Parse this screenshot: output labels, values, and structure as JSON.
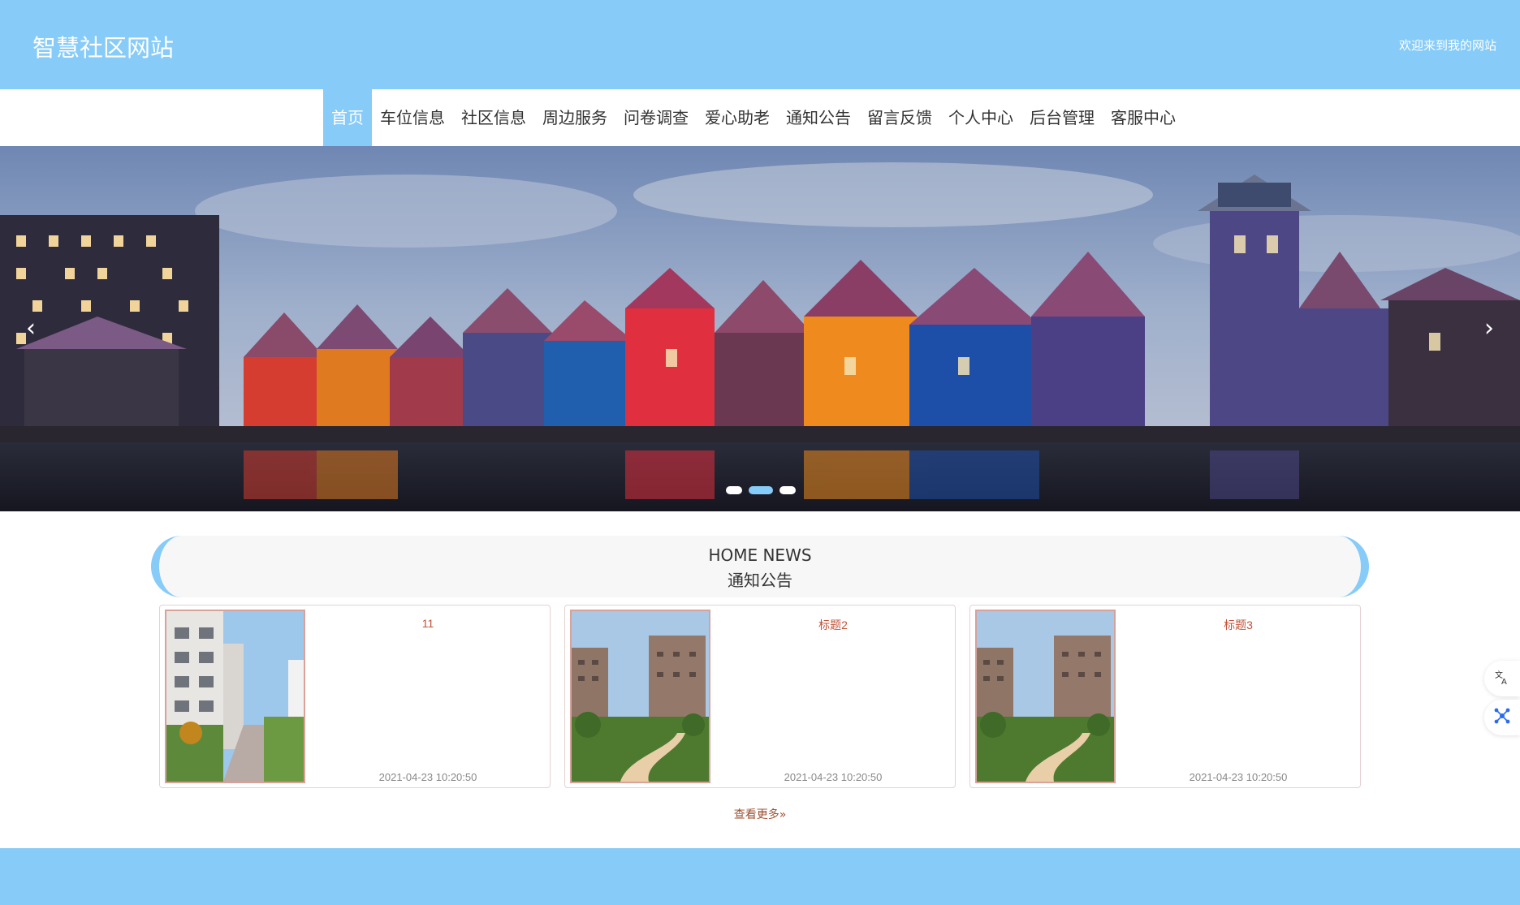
{
  "header": {
    "site_title": "智慧社区网站",
    "welcome_text": "欢迎来到我的网站"
  },
  "nav": {
    "items": [
      {
        "label": "首页",
        "active": true
      },
      {
        "label": "车位信息"
      },
      {
        "label": "社区信息"
      },
      {
        "label": "周边服务"
      },
      {
        "label": "问卷调查"
      },
      {
        "label": "爱心助老"
      },
      {
        "label": "通知公告"
      },
      {
        "label": "留言反馈"
      },
      {
        "label": "个人中心"
      },
      {
        "label": "后台管理"
      },
      {
        "label": "客服中心"
      }
    ]
  },
  "banner": {
    "prev_arrow": "‹",
    "next_arrow": "›",
    "slide_count": 3,
    "active_slide": 2
  },
  "news": {
    "title_en": "HOME NEWS",
    "title_cn": "通知公告",
    "cards": [
      {
        "title": "11",
        "date": "2021-04-23 10:20:50"
      },
      {
        "title": "标题2",
        "date": "2021-04-23 10:20:50"
      },
      {
        "title": "标题3",
        "date": "2021-04-23 10:20:50"
      }
    ],
    "more_label": "查看更多»"
  },
  "side_tools": {
    "translate_icon": "translate-icon",
    "ai_icon": "network-icon"
  },
  "colors": {
    "brand": "#87cbf8",
    "accent_text": "#c2533a"
  }
}
